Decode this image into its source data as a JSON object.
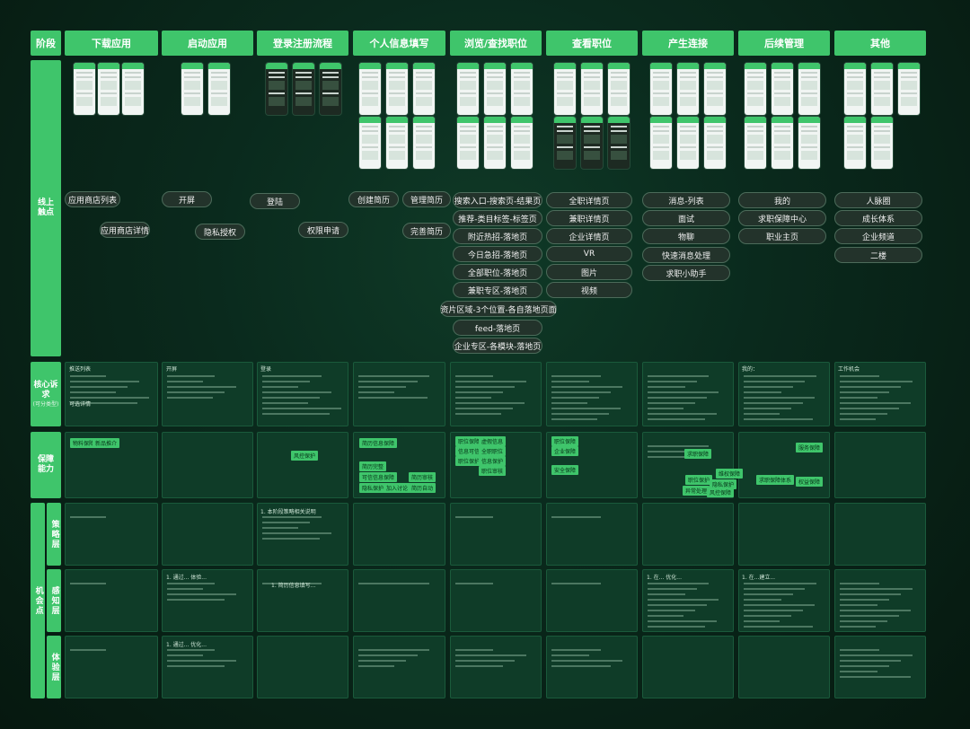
{
  "stages": [
    "阶段",
    "下载应用",
    "启动应用",
    "登录注册流程",
    "个人信息填写",
    "浏览/查找职位",
    "查看职位",
    "产生连接",
    "后续管理",
    "其他"
  ],
  "rows": {
    "touchpoints": {
      "line1": "线上",
      "line2": "触点"
    },
    "needs": {
      "label": "核心诉求",
      "sub": "(可分类型)"
    },
    "support": {
      "label": "保障能力"
    },
    "opportunity": "机会点",
    "strategy": "策略层",
    "perception": "感知层",
    "experience": "体验层"
  },
  "chips": {
    "c0": "应用商店列表",
    "c1": "应用商店详情",
    "c2": "开屏",
    "c3": "隐私授权",
    "c4": "登陆",
    "c5": "权限申请",
    "c6": "创建简历",
    "c7": "管理简历",
    "c8": "完善简历",
    "c9": "搜索入口-搜索页-结果页",
    "c10": "推荐-类目标签-标签页",
    "c11": "附近热招-落地页",
    "c12": "今日急招-落地页",
    "c13": "全部职位-落地页",
    "c14": "兼职专区-落地页",
    "c15": "资片区域-3个位置-各自落地页面",
    "c16": "feed-落地页",
    "c17": "企业专区-各模块-落地页",
    "c18": "全职详情页",
    "c19": "兼职详情页",
    "c20": "企业详情页",
    "c21": "VR",
    "c22": "图片",
    "c23": "视频",
    "c24": "消息-列表",
    "c25": "面试",
    "c26": "物聊",
    "c27": "快速消息处理",
    "c28": "求职小助手",
    "c29": "我的",
    "c30": "求职保障中心",
    "c31": "职业主页",
    "c32": "人脉圈",
    "c33": "成长体系",
    "c34": "企业频道",
    "c35": "二楼"
  },
  "needs_text": {
    "n1a": "推送列表",
    "n1b": "可选详情",
    "n2a": "开屏",
    "n3a": "登录",
    "n9a": "我的：",
    "n10a": "工作机会"
  },
  "tags": {
    "t1": "物料保障",
    "t2": "新品推介",
    "t3": "风控保护",
    "t4": "简历信息保障",
    "t5": "简历完整",
    "t6": "可信信息保障",
    "t7": "简历审核",
    "t8": "隐私保护",
    "t9": "加入讨论",
    "t10": "简历自动",
    "t11": "职位保障",
    "t12": "虚假信息",
    "t13": "信息可信",
    "t14": "全职职位",
    "t15": "职位保护",
    "t16": "信息保护",
    "t17": "职位审核",
    "t18": "职位保障",
    "t19": "企业保障",
    "t20": "安全保障",
    "t21": "求职保障",
    "t22": "维权保障",
    "t23": "职位保护",
    "t24": "隐私保护",
    "t25": "异常处理",
    "t26": "风控保障",
    "t27": "服务保障",
    "t28": "求职保障体系",
    "t29": "权益保障"
  },
  "opp_text": {
    "s3": "1. 本阶段策略相关说明",
    "p3": "1. 通过... 体验...",
    "e3": "1. 通过... 优化...",
    "p4": "1. 简历信息填写...",
    "p8": "1. 在... 优化...",
    "p9": "1. 在...建立..."
  }
}
